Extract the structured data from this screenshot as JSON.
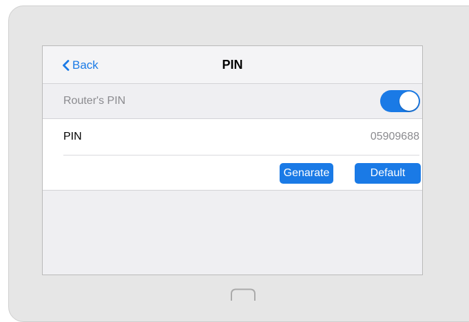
{
  "nav": {
    "back_label": "Back",
    "title": "PIN"
  },
  "router_pin": {
    "label": "Router's PIN",
    "enabled": true
  },
  "pin": {
    "label": "PIN",
    "value": "05909688"
  },
  "actions": {
    "generate_label": "Genarate",
    "default_label": "Default"
  },
  "colors": {
    "accent": "#1a7ae6",
    "device_frame": "#e6e6e6",
    "screen_bg": "#efeff2"
  },
  "icons": {
    "back": "chevron-left-icon",
    "home": "home-button-icon"
  }
}
